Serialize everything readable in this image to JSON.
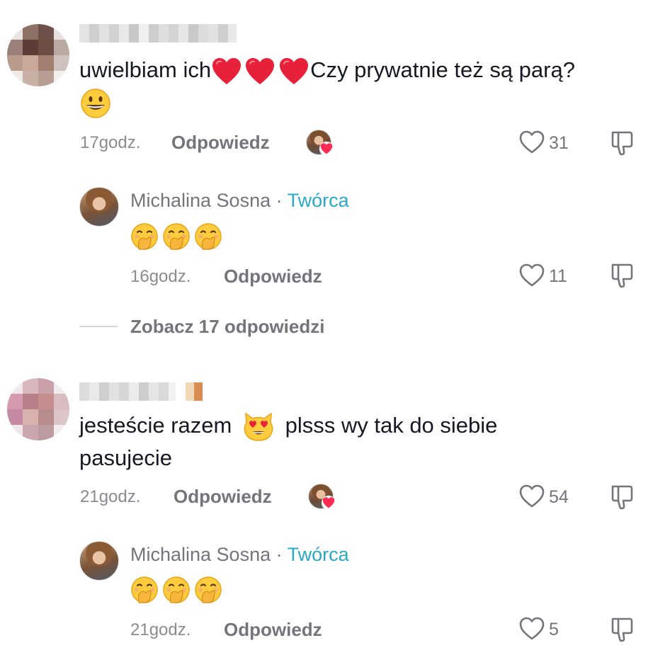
{
  "comments": [
    {
      "text_part1": "uwielbiam ich",
      "text_part2": "Czy prywatnie też są parą?",
      "time": "17godz.",
      "reply_label": "Odpowiedz",
      "likes": "31",
      "reply": {
        "author": "Michalina Sosna",
        "separator": "·",
        "tag": "Twórca",
        "time": "16godz.",
        "reply_label": "Odpowiedz",
        "likes": "11"
      },
      "view_replies": "Zobacz 17 odpowiedzi"
    },
    {
      "text_part1": "jesteście razem",
      "text_part2": "plsss wy tak do siebie",
      "text_line2": "pasujecie",
      "time": "21godz.",
      "reply_label": "Odpowiedz",
      "likes": "54",
      "reply": {
        "author": "Michalina Sosna",
        "separator": "·",
        "tag": "Twórca",
        "time": "21godz.",
        "reply_label": "Odpowiedz",
        "likes": "5"
      }
    }
  ],
  "colors": {
    "accent_creator": "#2aa8c9",
    "text_primary": "#161823",
    "text_secondary": "#74757b",
    "heart_red": "#e8213a"
  },
  "icons": [
    "avatar",
    "heart-emoji",
    "grinning-face-emoji",
    "hand-over-mouth-emoji",
    "heart-eyes-cat-emoji",
    "like-heart-icon",
    "dislike-icon",
    "creator-liked-badge-icon"
  ]
}
